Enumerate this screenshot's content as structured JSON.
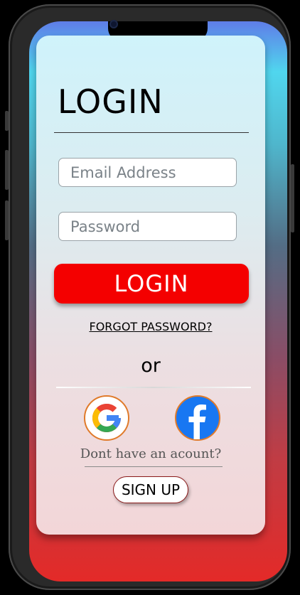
{
  "login": {
    "title": "LOGIN",
    "email": {
      "placeholder": "Email Address",
      "value": ""
    },
    "password": {
      "placeholder": "Password",
      "value": ""
    },
    "login_button": "LOGIN",
    "forgot_password": "FORGOT PASSWORD?",
    "or": "or",
    "social": [
      {
        "icon": "google-icon",
        "color": "#ffffff"
      },
      {
        "icon": "facebook-icon",
        "color": "#1877f2"
      }
    ],
    "no_account": "Dont have an acount?",
    "signup_button": "SIGN UP"
  },
  "colors": {
    "accent": "#f40000",
    "gradient_top": "#50d6ee",
    "gradient_bottom": "#e42a28"
  }
}
